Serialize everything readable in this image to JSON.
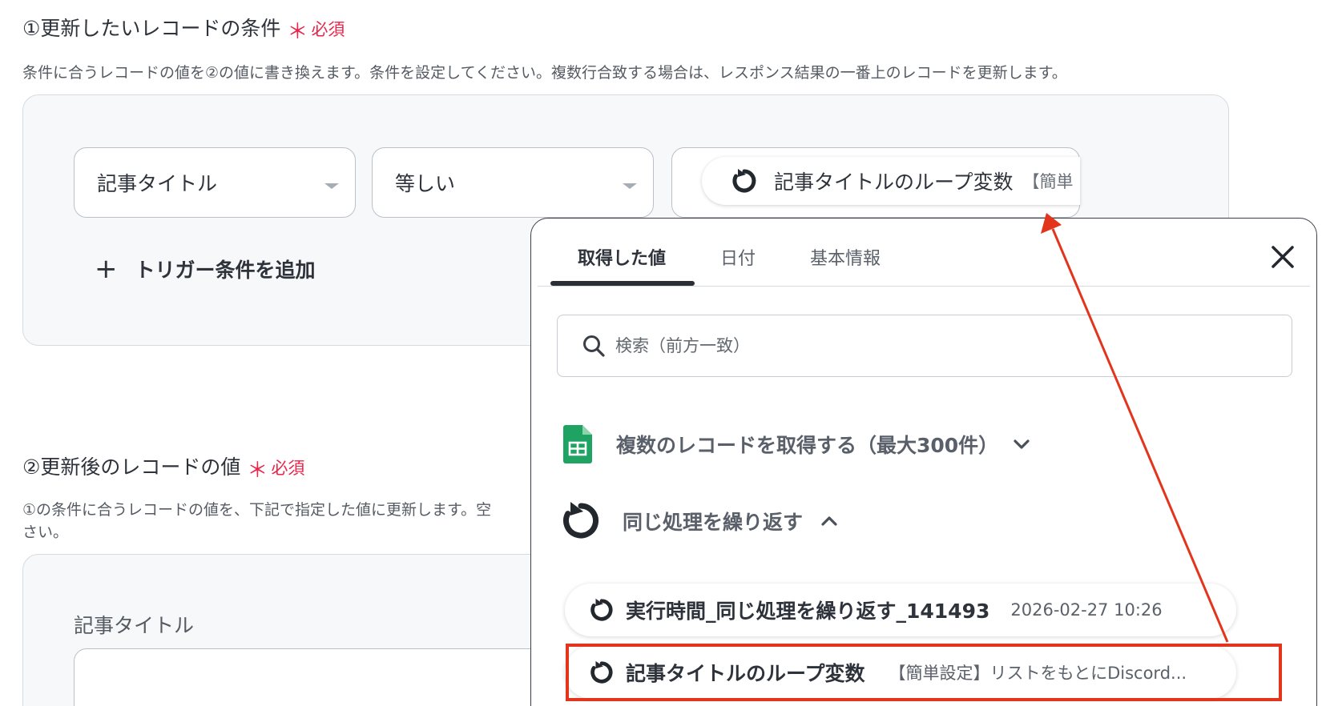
{
  "section1": {
    "title": "①更新したいレコードの条件",
    "required_mark": "＊",
    "required_label": "必須",
    "description": "条件に合うレコードの値を②の値に書き換えます。条件を設定してください。複数行合致する場合は、レスポンス結果の一番上のレコードを更新します。",
    "field_select": "記事タイトル",
    "operator_select": "等しい",
    "value_chip_label": "記事タイトルのループ変数",
    "value_chip_meta": "【簡単",
    "add_trigger_label": "トリガー条件を追加"
  },
  "section2": {
    "title": "②更新後のレコードの値",
    "required_mark": "＊",
    "required_label": "必須",
    "description_line1": "①の条件に合うレコードの値を、下記で指定した値に更新します。空",
    "description_line2": "さい。",
    "field_label": "記事タイトル",
    "field_value": ""
  },
  "popup": {
    "tabs": [
      {
        "label": "取得した値",
        "active": true
      },
      {
        "label": "日付",
        "active": false
      },
      {
        "label": "基本情報",
        "active": false
      }
    ],
    "search_placeholder": "検索（前方一致）",
    "groups": [
      {
        "label": "複数のレコードを取得する（最大300件）",
        "icon": "google-sheets-icon",
        "expanded": false
      },
      {
        "label": "同じ処理を繰り返す",
        "icon": "loop-icon",
        "expanded": true
      }
    ],
    "items": [
      {
        "label": "実行時間_同じ処理を繰り返す_141493",
        "meta": "2026-02-27 10:26"
      },
      {
        "label": "記事タイトルのループ変数",
        "meta": "【簡単設定】リストをもとにDiscord..."
      }
    ]
  },
  "colors": {
    "required": "#e8254a",
    "annotation": "#e3341c",
    "sheets_green": "#1ea362"
  }
}
